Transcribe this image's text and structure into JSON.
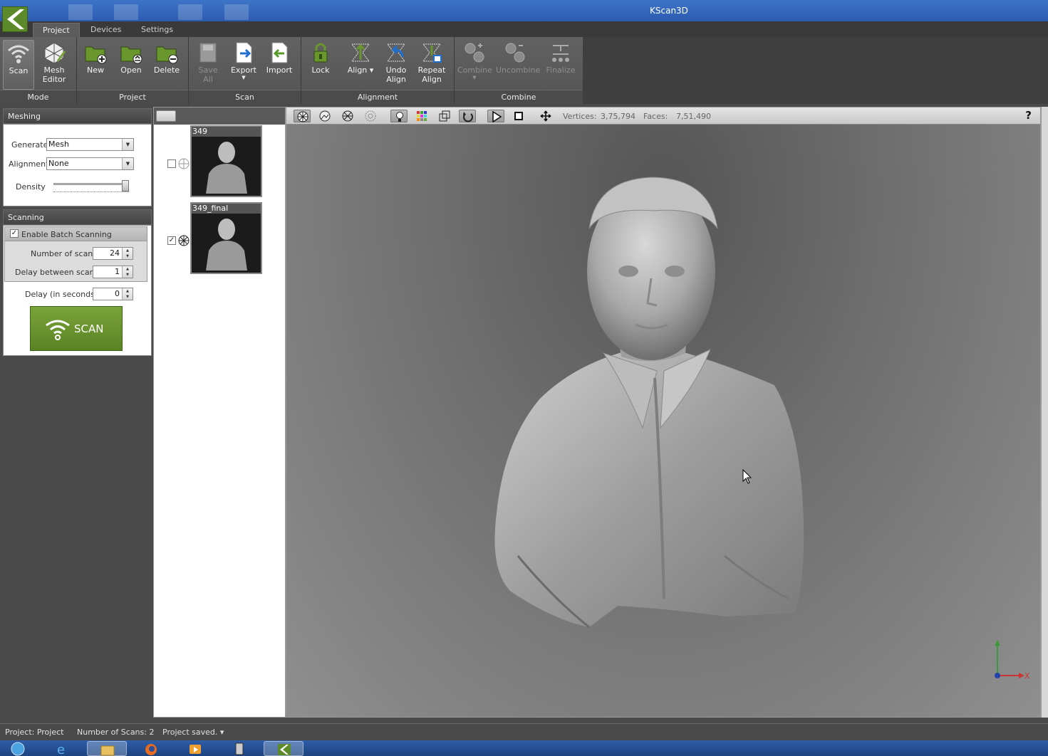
{
  "window": {
    "title": "KScan3D"
  },
  "tabs": [
    {
      "label": "Project",
      "active": true
    },
    {
      "label": "Devices",
      "active": false
    },
    {
      "label": "Settings",
      "active": false
    }
  ],
  "ribbon": {
    "mode": {
      "label": "Mode",
      "scan": "Scan",
      "mesh_editor_1": "Mesh",
      "mesh_editor_2": "Editor"
    },
    "project": {
      "label": "Project",
      "new": "New",
      "open": "Open",
      "delete": "Delete"
    },
    "scan": {
      "label": "Scan",
      "save_all": "Save All",
      "export": "Export",
      "import": "Import"
    },
    "alignment": {
      "label": "Alignment",
      "lock": "Lock",
      "align": "Align",
      "undo_align_1": "Undo",
      "undo_align_2": "Align",
      "repeat_align_1": "Repeat",
      "repeat_align_2": "Align"
    },
    "combine": {
      "label": "Combine",
      "combine": "Combine",
      "uncombine": "Uncombine",
      "finalize": "Finalize"
    }
  },
  "meshing": {
    "title": "Meshing",
    "generate_label": "Generate",
    "generate_value": "Mesh",
    "alignment_label": "Alignment",
    "alignment_value": "None",
    "density_label": "Density",
    "density_level": 1.0
  },
  "scanning": {
    "title": "Scanning",
    "batch_label": "Enable Batch Scanning",
    "batch_enabled": true,
    "num_scans_label": "Number of scans",
    "num_scans_value": "24",
    "delay_between_label": "Delay between scans",
    "delay_between_value": "1",
    "delay_label": "Delay (in seconds)",
    "delay_value": "0",
    "scan_button": "SCAN"
  },
  "scan_list": [
    {
      "name": "349",
      "checked": false
    },
    {
      "name": "349_final",
      "checked": true
    }
  ],
  "viewport": {
    "vertices_label": "Vertices:",
    "vertices_value": "3,75,794",
    "faces_label": "Faces:",
    "faces_value": "7,51,490",
    "help": "?",
    "axis_x": "X"
  },
  "status": {
    "project": "Project:  Project",
    "scans": "Number of Scans:  2",
    "saved": "Project saved."
  },
  "colors": {
    "accent_green": "#6a962e",
    "titlebar_blue": "#2c5bb0",
    "ribbon_gray": "#5a5a5a"
  }
}
